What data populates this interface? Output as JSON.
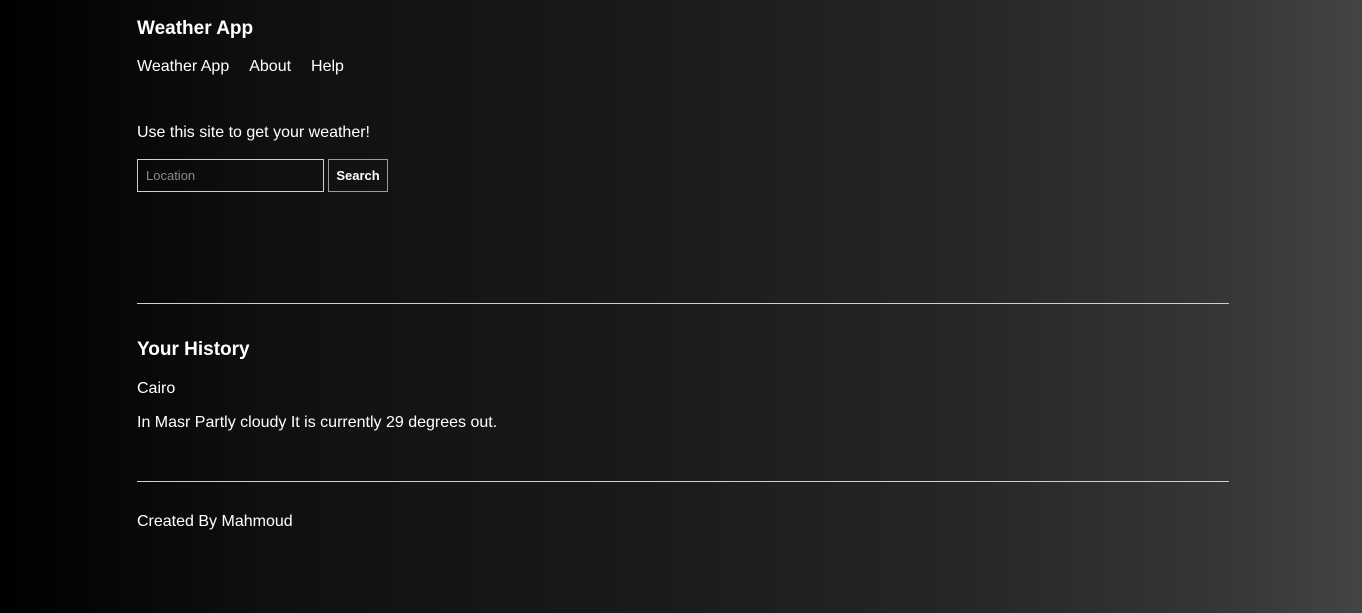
{
  "header": {
    "title": "Weather App",
    "nav": [
      {
        "label": "Weather App"
      },
      {
        "label": "About"
      },
      {
        "label": "Help"
      }
    ]
  },
  "main": {
    "intro": "Use this site to get your weather!",
    "search": {
      "placeholder": "Location",
      "value": "",
      "button_label": "Search"
    }
  },
  "history": {
    "title": "Your History",
    "location": "Cairo",
    "forecast": "In Masr Partly cloudy It is currently 29 degrees out."
  },
  "footer": {
    "text": "Created By Mahmoud"
  },
  "colors": {
    "text": "#ffffff",
    "background_start": "#000000",
    "background_end": "#444444",
    "divider": "#d0d0d0",
    "placeholder": "#8a8a8a"
  }
}
